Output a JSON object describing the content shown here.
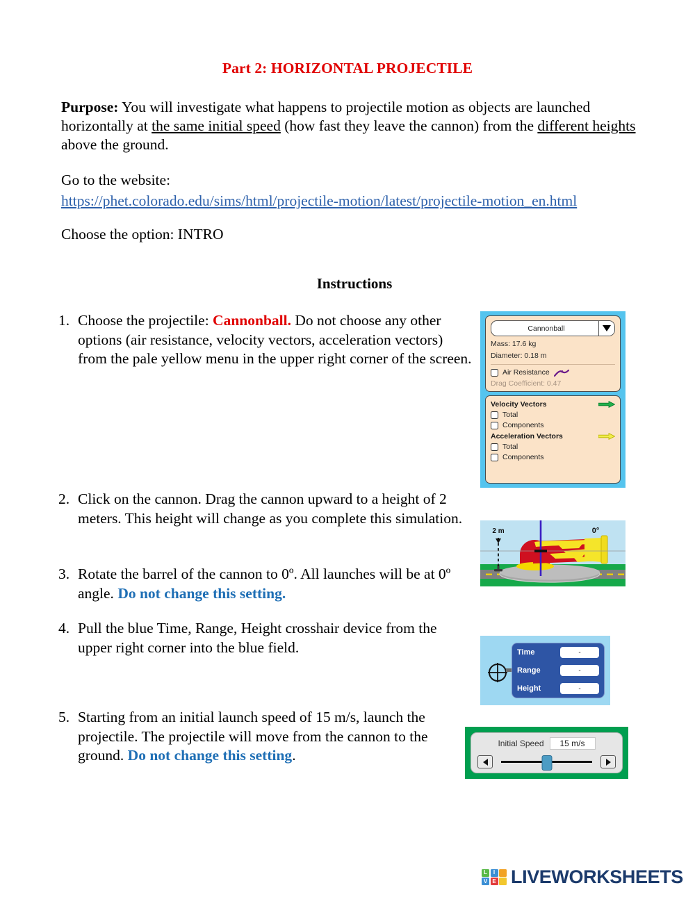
{
  "document": {
    "title": "Part 2:  HORIZONTAL PROJECTILE",
    "purpose_label": "Purpose:",
    "purpose_text_1": " You will investigate what happens to projectile motion as objects are launched horizontally at ",
    "purpose_underline_1": "the same initial speed",
    "purpose_text_2": " (how fast they leave the cannon) from the ",
    "purpose_underline_2": "different heights",
    "purpose_text_3": " above the ground.",
    "goto_label": "Go to the website:",
    "url": "https://phet.colorado.edu/sims/html/projectile-motion/latest/projectile-motion_en.html",
    "choose_option": "Choose the option:  INTRO",
    "instructions_heading": "Instructions"
  },
  "items": [
    {
      "number": "1.",
      "text_1": "Choose the projectile: ",
      "highlight": "Cannonball.",
      "highlight_color": "#e00000",
      "text_2": "  Do not choose any other options (air resistance, velocity vectors, acceleration vectors) from the pale yellow menu in the upper right corner of the screen."
    },
    {
      "number": "2.",
      "text_1": "Click on the cannon.  Drag the cannon upward to a height of 2 meters.  This height will change as you complete this simulation.",
      "highlight": "",
      "text_2": ""
    },
    {
      "number": "3.",
      "text_1": "Rotate the barrel of the cannon to 0º.  All launches will be at 0º angle. ",
      "highlight": "Do not change this setting.",
      "highlight_color": "#1f6fb5",
      "text_2": ""
    },
    {
      "number": "4.",
      "text_1": "Pull the blue Time, Range, Height crosshair device from the upper right corner into the blue field.",
      "highlight": "",
      "text_2": ""
    },
    {
      "number": "5.",
      "text_1": "Starting from an initial launch speed of 15 m/s, launch the projectile.  The projectile will move from the cannon to the ground.  ",
      "highlight": "Do not change this setting",
      "highlight_color": "#1f6fb5",
      "text_2": "."
    }
  ],
  "control_panel": {
    "projectile_selected": "Cannonball",
    "mass": "Mass: 17.6 kg",
    "diameter": "Diameter: 0.18 m",
    "air_resistance_label": "Air Resistance",
    "drag_coefficient": "Drag Coefficient: 0.47",
    "velocity_vectors_title": "Velocity Vectors",
    "velocity_total": "Total",
    "velocity_components": "Components",
    "acceleration_vectors_title": "Acceleration Vectors",
    "acceleration_total": "Total",
    "acceleration_components": "Components",
    "velocity_arrow_color": "#22b14c",
    "acceleration_arrow_color": "#e8e43a",
    "panel_fill": "#fbe3c8",
    "background": "#55c4ee"
  },
  "cannon_figure": {
    "height_label": "2 m",
    "angle_label": "0°",
    "sky_color": "#bfe2f2",
    "grass_color": "#16a94a",
    "road_color": "#808080",
    "cannon_color": "#cf1020",
    "flame_color": "#f5e52a"
  },
  "measurement_tool": {
    "rows": [
      {
        "label": "Time",
        "value": "-"
      },
      {
        "label": "Range",
        "value": "-"
      },
      {
        "label": "Height",
        "value": "-"
      }
    ],
    "panel_color": "#2e55a5",
    "background": "#9ed8f2"
  },
  "speed_control": {
    "label": "Initial Speed",
    "value": "15 m/s",
    "decrement_icon": "left-triangle-icon",
    "increment_icon": "right-triangle-icon",
    "border_color": "#009e4f"
  },
  "footer": {
    "logo_cells": [
      {
        "letter": "L",
        "color": "#58b947"
      },
      {
        "letter": "I",
        "color": "#3b8fd4"
      },
      {
        "letter": "",
        "color": "#f2a325"
      },
      {
        "letter": "V",
        "color": "#3b8fd4"
      },
      {
        "letter": "E",
        "color": "#e23b3b"
      },
      {
        "letter": "",
        "color": "#f2c72e"
      }
    ],
    "brand": "LIVEWORKSHEETS",
    "brand_color": "#1b3a6b"
  }
}
